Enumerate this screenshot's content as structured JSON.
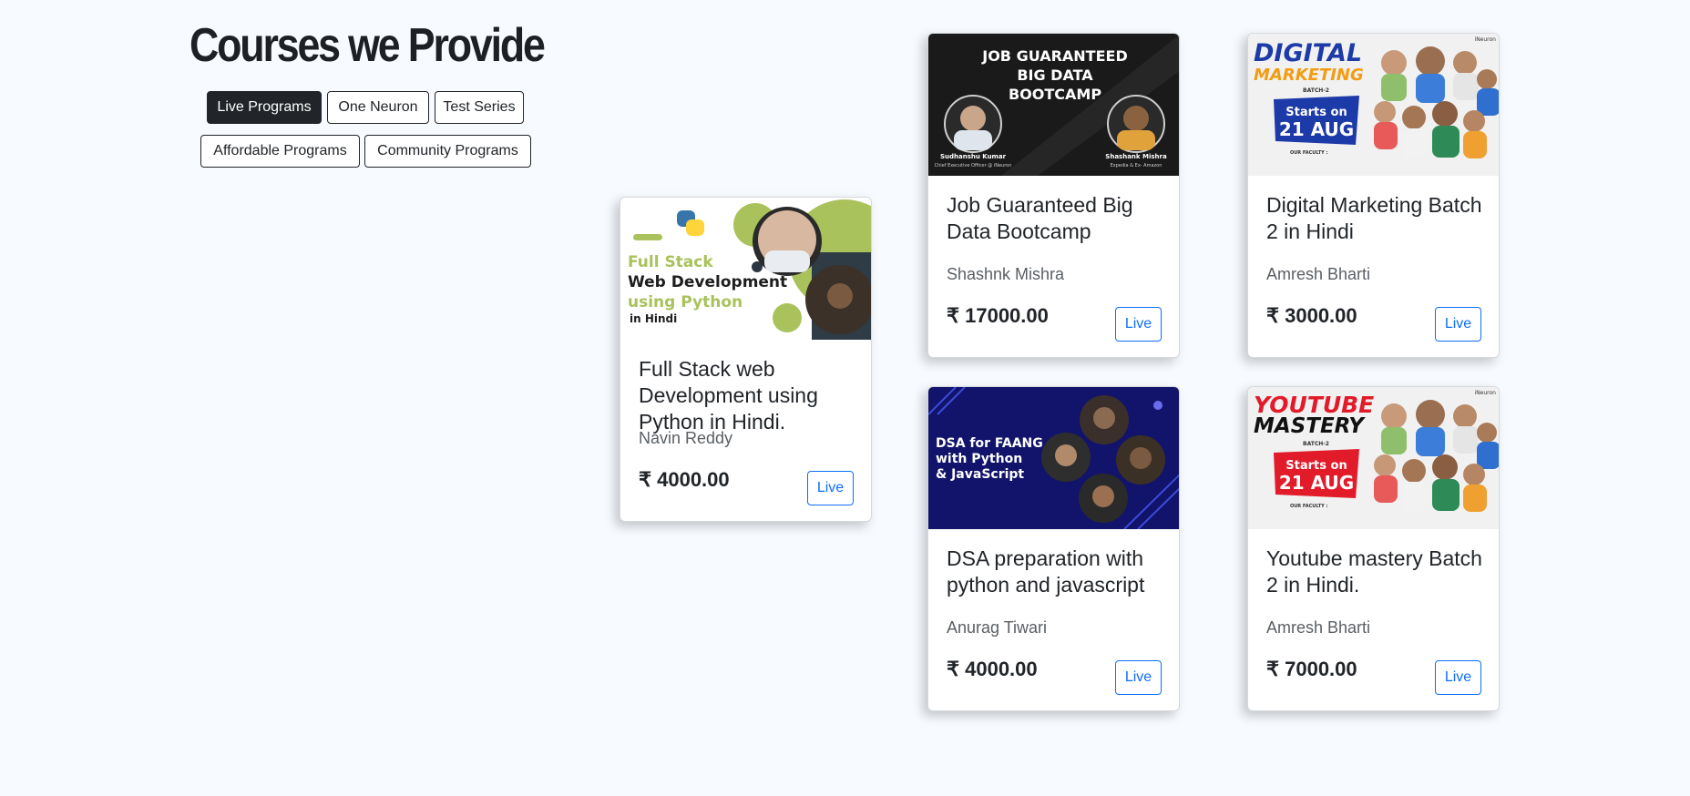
{
  "page": {
    "heading": "Courses we Provide"
  },
  "filters": [
    {
      "label": "Live Programs",
      "active": true
    },
    {
      "label": "One Neuron",
      "active": false
    },
    {
      "label": "Test Series",
      "active": false
    },
    {
      "label": "Affordable Programs",
      "active": false
    },
    {
      "label": "Community Programs",
      "active": false
    }
  ],
  "courses": [
    {
      "title": "Full Stack web Development using Python in Hindi.",
      "author": "Navin Reddy",
      "price": "₹ 4000.00",
      "button": "Live",
      "thumb": {
        "line1": "Full Stack",
        "line2": "Web Development",
        "line3": "using Python",
        "line4": "in Hindi"
      }
    },
    {
      "title": "Job Guaranteed Big Data Bootcamp",
      "author": "Shashnk Mishra",
      "price": "₹ 17000.00",
      "button": "Live",
      "thumb": {
        "line1": "JOB GUARANTEED",
        "line2": "BIG DATA",
        "line3": "BOOTCAMP",
        "left_name": "Sudhanshu Kumar",
        "left_role": "Chief Executive Officer @ iNeuron",
        "right_name": "Shashank Mishra",
        "right_role": "Expedia & Ex- Amazon"
      }
    },
    {
      "title": "Digital Marketing Batch 2 in Hindi",
      "author": "Amresh Bharti",
      "price": "₹ 3000.00",
      "button": "Live",
      "thumb": {
        "line1": "DIGITAL",
        "line2": "MARKETING",
        "batch": "BATCH-2",
        "starts": "Starts on",
        "date": "21 AUG",
        "brand": "iNeuron",
        "faculty": "OUR FACULTY :"
      }
    },
    {
      "title": "DSA preparation with python and javascript",
      "author": "Anurag Tiwari",
      "price": "₹ 4000.00",
      "button": "Live",
      "thumb": {
        "line1": "DSA for FAANG",
        "line2": "with Python",
        "line3": "& JavaScript"
      }
    },
    {
      "title": "Youtube mastery Batch 2 in Hindi.",
      "author": "Amresh Bharti",
      "price": "₹ 7000.00",
      "button": "Live",
      "thumb": {
        "line1": "YOUTUBE",
        "line2": "MASTERY",
        "batch": "BATCH-2",
        "starts": "Starts on",
        "date": "21 AUG",
        "brand": "iNeuron",
        "faculty": "OUR FACULTY :"
      }
    }
  ],
  "colors": {
    "page_bg": "#f7fbff",
    "dark": "#212529",
    "live_blue": "#0d6efd",
    "python_green": "#a9c25b",
    "dsa_navy": "#12136b",
    "promo_red": "#e21b2b",
    "promo_blue": "#1c3aa8"
  }
}
